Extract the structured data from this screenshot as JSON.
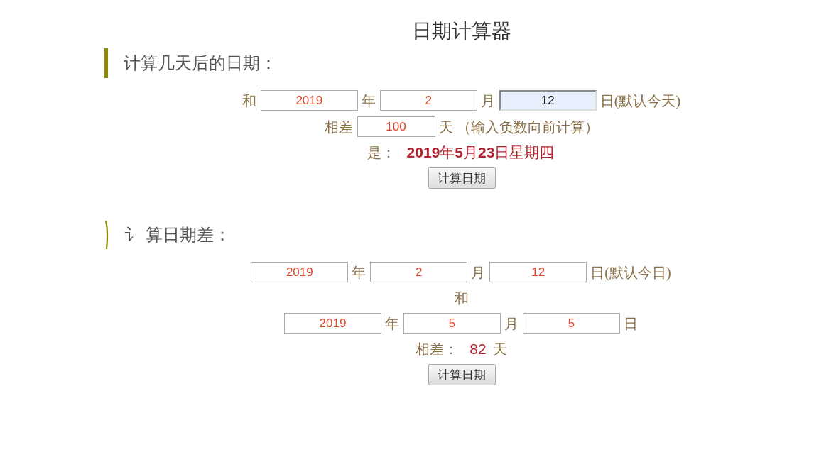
{
  "title": "日期计算器",
  "sections": [
    {
      "heading": "计算几天后的日期：",
      "kind": "bar",
      "rows": [
        {
          "items": [
            {
              "kind": "label",
              "text": "和"
            },
            {
              "kind": "field",
              "value": "2019",
              "focused": false
            },
            {
              "kind": "label",
              "text": "年"
            },
            {
              "kind": "field",
              "value": "2",
              "focused": false
            },
            {
              "kind": "label",
              "text": "月"
            },
            {
              "kind": "field",
              "value": "12",
              "focused": true
            },
            {
              "kind": "label",
              "text": "日(默认今天)"
            }
          ]
        },
        {
          "items": [
            {
              "kind": "label",
              "text": "相差"
            },
            {
              "kind": "field",
              "value": "100",
              "focused": false
            },
            {
              "kind": "label",
              "text": "天 （输入负数向前计算）"
            }
          ]
        },
        {
          "items": [
            {
              "kind": "label",
              "text": "是："
            },
            {
              "kind": "result",
              "text": "**2019**年**5**月**23**日星期四"
            }
          ]
        },
        {
          "items": [
            {
              "kind": "button",
              "text": "计算日期"
            }
          ]
        }
      ]
    },
    {
      "heading": "讠 算日期差：",
      "kind": "curve",
      "rows": [
        {
          "items": [
            {
              "kind": "field",
              "value": "2019",
              "focused": false
            },
            {
              "kind": "label",
              "text": "年"
            },
            {
              "kind": "field",
              "value": "2",
              "focused": false
            },
            {
              "kind": "label",
              "text": "月"
            },
            {
              "kind": "field",
              "value": "12",
              "focused": false
            },
            {
              "kind": "label",
              "text": "日(默认今日)"
            }
          ]
        },
        {
          "items": [
            {
              "kind": "label",
              "text": "和"
            }
          ]
        },
        {
          "items": [
            {
              "kind": "field",
              "value": "2019",
              "focused": false
            },
            {
              "kind": "label",
              "text": "年"
            },
            {
              "kind": "field",
              "value": "5",
              "focused": false
            },
            {
              "kind": "label",
              "text": "月"
            },
            {
              "kind": "field",
              "value": "5",
              "focused": false
            },
            {
              "kind": "label",
              "text": "日"
            }
          ]
        },
        {
          "items": [
            {
              "kind": "label",
              "text": "相差："
            },
            {
              "kind": "result",
              "text": "82"
            },
            {
              "kind": "label",
              "text": "天"
            }
          ]
        },
        {
          "items": [
            {
              "kind": "button",
              "text": "计算日期"
            }
          ]
        }
      ]
    }
  ]
}
